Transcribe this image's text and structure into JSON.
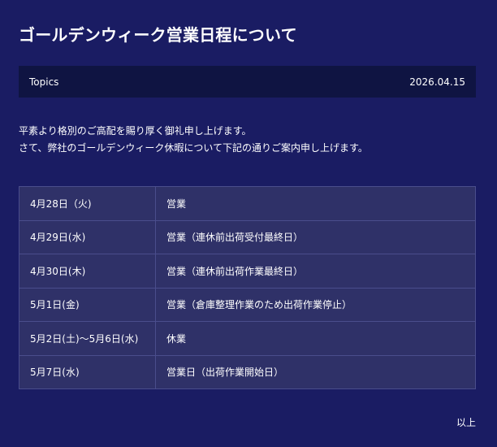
{
  "page_title": "ゴールデンウィーク営業日程について",
  "meta": {
    "category": "Topics",
    "date": "2026.04.15"
  },
  "intro": {
    "line1": "平素より格別のご高配を賜り厚く御礼申し上げます。",
    "line2": "さて、弊社のゴールデンウィーク休暇について下記の通りご案内申し上げます。"
  },
  "schedule": [
    {
      "date": "4月28日（火)",
      "status": "営業"
    },
    {
      "date": "4月29日(水)",
      "status": "営業（連休前出荷受付最終日）"
    },
    {
      "date": "4月30日(木)",
      "status": "営業（連休前出荷作業最終日）"
    },
    {
      "date": "5月1日(金)",
      "status": "営業（倉庫整理作業のため出荷作業停止）"
    },
    {
      "date": "5月2日(土)～5月6日(水)",
      "status": "休業"
    },
    {
      "date": "5月7日(水)",
      "status": "営業日（出荷作業開始日）"
    }
  ],
  "footer": {
    "closing": "以上"
  }
}
